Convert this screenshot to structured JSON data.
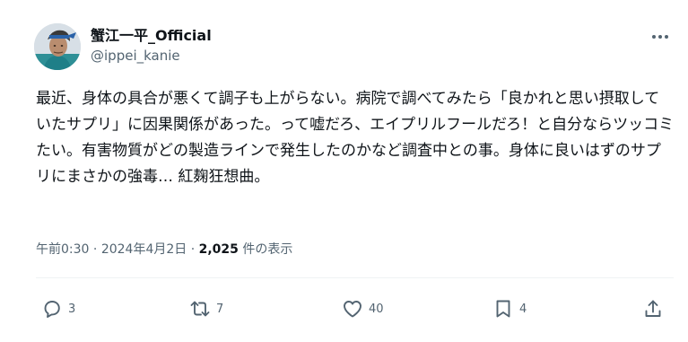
{
  "author": {
    "display_name": "蟹江一平_Official",
    "handle": "@ippei_kanie",
    "avatar_icon": "avatar-portrait"
  },
  "tweet": {
    "text": "最近、身体の具合が悪くて調子も上がらない。病院で調べてみたら「良かれと思い摂取していたサプリ」に因果関係があった。って嘘だろ、エイプリルフールだろ！と自分ならツッコミたい。有害物質がどの製造ラインで発生したのかなど調査中との事。身体に良いはずのサプリにまさかの強毒… 紅麹狂想曲。"
  },
  "meta": {
    "time": "午前0:30",
    "separator": "·",
    "date": "2024年4月2日",
    "views_count": "2,025",
    "views_label": "件の表示"
  },
  "actions": {
    "reply_count": "3",
    "retweet_count": "7",
    "like_count": "40",
    "bookmark_count": "4",
    "icons": [
      "reply-icon",
      "retweet-icon",
      "like-icon",
      "bookmark-icon",
      "share-icon"
    ]
  },
  "colors": {
    "text": "#0f1419",
    "secondary": "#536471",
    "divider": "#eff3f4"
  }
}
